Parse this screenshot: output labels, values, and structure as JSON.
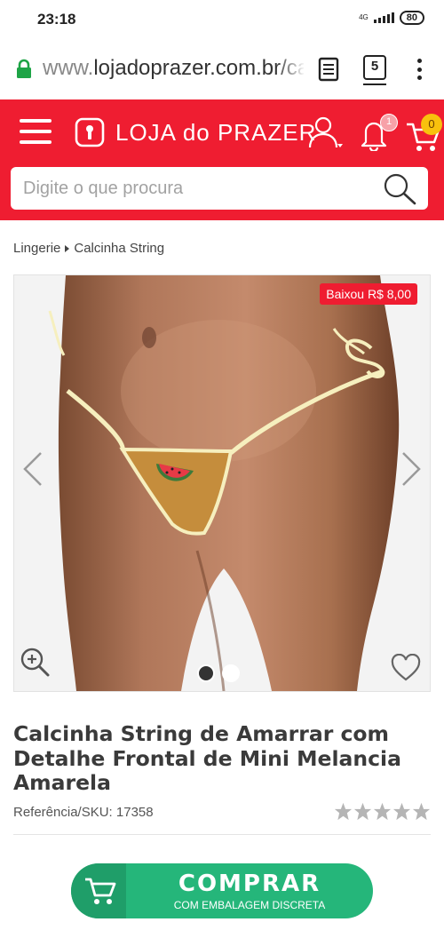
{
  "status_bar": {
    "time": "23:18",
    "network": "4G",
    "battery": "80"
  },
  "browser": {
    "url_scheme": "www.",
    "url_main": "lojadoprazer.com.br/ca",
    "tab_count": "5",
    "icons": [
      "lock-icon",
      "reader-mode-icon",
      "tabs-icon",
      "overflow-menu-icon"
    ]
  },
  "header": {
    "logo_text": "LOJA do PRAZER",
    "notification_count": "1",
    "cart_count": "0",
    "brand_color": "#ef1d31",
    "icons": [
      "hamburger-menu-icon",
      "keyhole-logo-icon",
      "user-icon",
      "bell-icon",
      "cart-icon"
    ]
  },
  "search": {
    "placeholder": "Digite o que procura",
    "value": ""
  },
  "breadcrumb": {
    "items": [
      "Lingerie",
      "Calcinha String"
    ]
  },
  "gallery": {
    "discount_badge": "Baixou R$ 8,00",
    "active_slide": 1,
    "slide_count": 2,
    "icons": [
      "chevron-left-icon",
      "chevron-right-icon",
      "zoom-in-icon",
      "heart-icon"
    ]
  },
  "product": {
    "title": "Calcinha String de Amarrar com Detalhe Frontal de Mini Melancia Amarela",
    "sku": "Referência/SKU: 17358",
    "rating_stars": 0,
    "rating_max": 5
  },
  "buy": {
    "label": "COMPRAR",
    "sublabel": "COM EMBALAGEM DISCRETA",
    "color": "#25b67a"
  }
}
